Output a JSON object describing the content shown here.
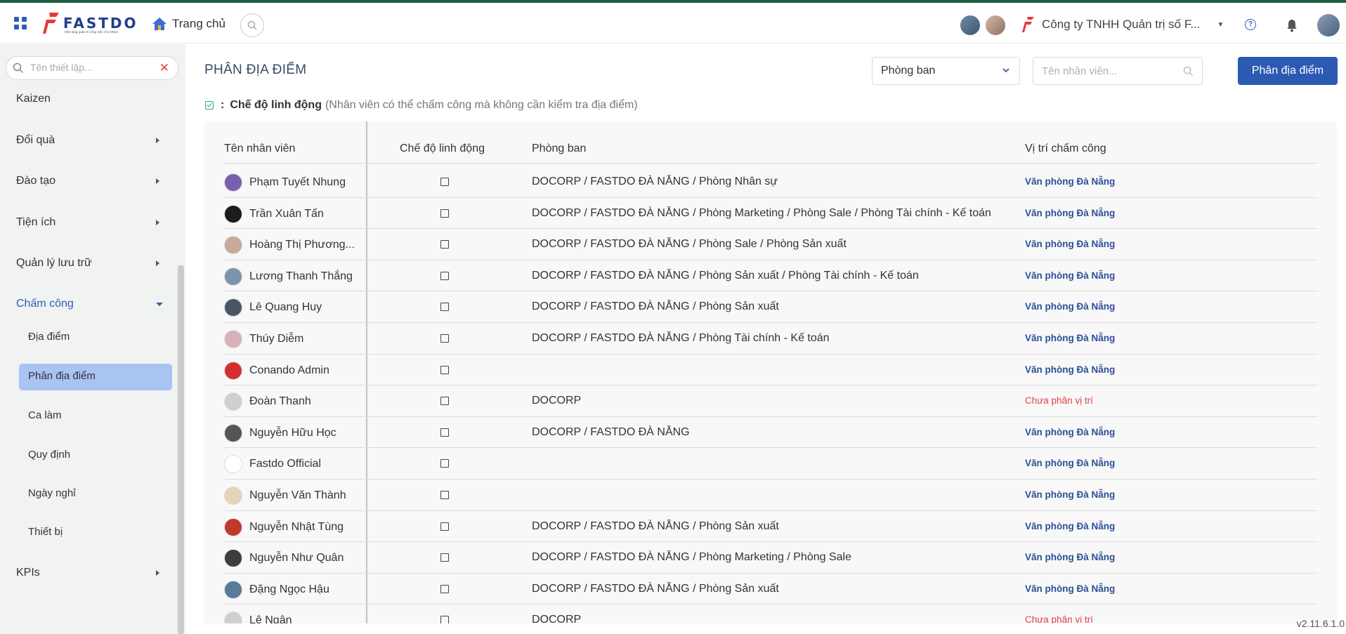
{
  "app": {
    "brand": "FASTDO",
    "brand_tagline": "Nền tảng quản trị công việc cho DNSs",
    "home_label": "Trang chủ",
    "company": "Công ty TNHH Quản trị số F...",
    "version": "v2.11.6.1.0"
  },
  "sidebar": {
    "search_placeholder": "Tên thiết lập...",
    "items": [
      {
        "label": "Kaizen",
        "has_arrow": false
      },
      {
        "label": "Đổi quà",
        "has_arrow": true
      },
      {
        "label": "Đào tạo",
        "has_arrow": true
      },
      {
        "label": "Tiện ích",
        "has_arrow": true
      },
      {
        "label": "Quản lý lưu trữ",
        "has_arrow": true
      },
      {
        "label": "Chấm công",
        "has_arrow": true,
        "expanded": true
      },
      {
        "label": "KPIs",
        "has_arrow": true
      }
    ],
    "sub_items": [
      {
        "label": "Địa điểm"
      },
      {
        "label": "Phân địa điểm",
        "active": true
      },
      {
        "label": "Ca làm"
      },
      {
        "label": "Quy định"
      },
      {
        "label": "Ngày nghỉ"
      },
      {
        "label": "Thiết bị"
      }
    ]
  },
  "main": {
    "title": "PHÂN ĐỊA ĐIỂM",
    "department_select": "Phòng ban",
    "employee_search_placeholder": "Tên nhân viên...",
    "assign_button": "Phân địa điểm",
    "legend": {
      "colon": ":",
      "label": "Chế độ linh động",
      "description": "(Nhân viên có thể chấm công mà không cần kiểm tra địa điểm)"
    },
    "table": {
      "headers": [
        "Tên nhân viên",
        "Chế độ linh động",
        "Phòng ban",
        "Vị trí chấm công"
      ],
      "rows": [
        {
          "name": "Phạm Tuyết Nhung",
          "dept": "DOCORP / FASTDO ĐÀ NẴNG / Phòng Nhân sự",
          "location": "Văn phòng Đà Nẵng",
          "assigned": true,
          "avatar_color": "#7a5fb0"
        },
        {
          "name": "Trần Xuân Tấn",
          "dept": "DOCORP / FASTDO ĐÀ NẴNG / Phòng Marketing / Phòng Sale / Phòng Tài chính - Kế toán",
          "location": "Văn phòng Đà Nẵng",
          "assigned": true,
          "avatar_color": "#1c1c1c"
        },
        {
          "name": "Hoàng Thị Phương...",
          "dept": "DOCORP / FASTDO ĐÀ NẴNG / Phòng Sale / Phòng Sản xuất",
          "location": "Văn phòng Đà Nẵng",
          "assigned": true,
          "avatar_color": "#c9a99a"
        },
        {
          "name": "Lương Thanh Thắng",
          "dept": "DOCORP / FASTDO ĐÀ NẴNG / Phòng Sản xuất / Phòng Tài chính - Kế toán",
          "location": "Văn phòng Đà Nẵng",
          "assigned": true,
          "avatar_color": "#7d93ad"
        },
        {
          "name": "Lê Quang Huy",
          "dept": "DOCORP / FASTDO ĐÀ NẴNG / Phòng Sản xuất",
          "location": "Văn phòng Đà Nẵng",
          "assigned": true,
          "avatar_color": "#4b5566"
        },
        {
          "name": "Thúy Diễm",
          "dept": "DOCORP / FASTDO ĐÀ NẴNG / Phòng Tài chính - Kế toán",
          "location": "Văn phòng Đà Nẵng",
          "assigned": true,
          "avatar_color": "#d8b0b8"
        },
        {
          "name": "Conando Admin",
          "dept": "",
          "location": "Văn phòng Đà Nẵng",
          "assigned": true,
          "avatar_color": "#d32f2f"
        },
        {
          "name": "Đoàn Thanh",
          "dept": "DOCORP",
          "location": "Chưa phân vị trí",
          "assigned": false,
          "avatar_color": "#cfcfcf"
        },
        {
          "name": "Nguyễn Hữu Học",
          "dept": "DOCORP / FASTDO ĐÀ NẴNG",
          "location": "Văn phòng Đà Nẵng",
          "assigned": true,
          "avatar_color": "#555555"
        },
        {
          "name": "Fastdo Official",
          "dept": "",
          "location": "Văn phòng Đà Nẵng",
          "assigned": true,
          "avatar_color": "#ffffff"
        },
        {
          "name": "Nguyễn Văn Thành",
          "dept": "",
          "location": "Văn phòng Đà Nẵng",
          "assigned": true,
          "avatar_color": "#e8d2b8"
        },
        {
          "name": "Nguyễn Nhật Tùng",
          "dept": "DOCORP / FASTDO ĐÀ NẴNG / Phòng Sản xuất",
          "location": "Văn phòng Đà Nẵng",
          "assigned": true,
          "avatar_color": "#c0392b"
        },
        {
          "name": "Nguyễn Như Quân",
          "dept": "DOCORP / FASTDO ĐÀ NẴNG / Phòng Marketing / Phòng Sale",
          "location": "Văn phòng Đà Nẵng",
          "assigned": true,
          "avatar_color": "#3d3d3d"
        },
        {
          "name": "Đặng Ngọc Hậu",
          "dept": "DOCORP / FASTDO ĐÀ NẴNG / Phòng Sản xuất",
          "location": "Văn phòng Đà Nẵng",
          "assigned": true,
          "avatar_color": "#5a7a99"
        },
        {
          "name": "Lê Ngân",
          "dept": "DOCORP",
          "location": "Chưa phân vị trí",
          "assigned": false,
          "avatar_color": "#cfcfcf"
        }
      ]
    }
  },
  "colors": {
    "accent": "#2c5ab3",
    "location_text": "#2c4f96",
    "unassigned_text": "#e0404a",
    "sidebar_bg": "#f0f3f2",
    "sidebar_active": "#a9c3f2"
  }
}
